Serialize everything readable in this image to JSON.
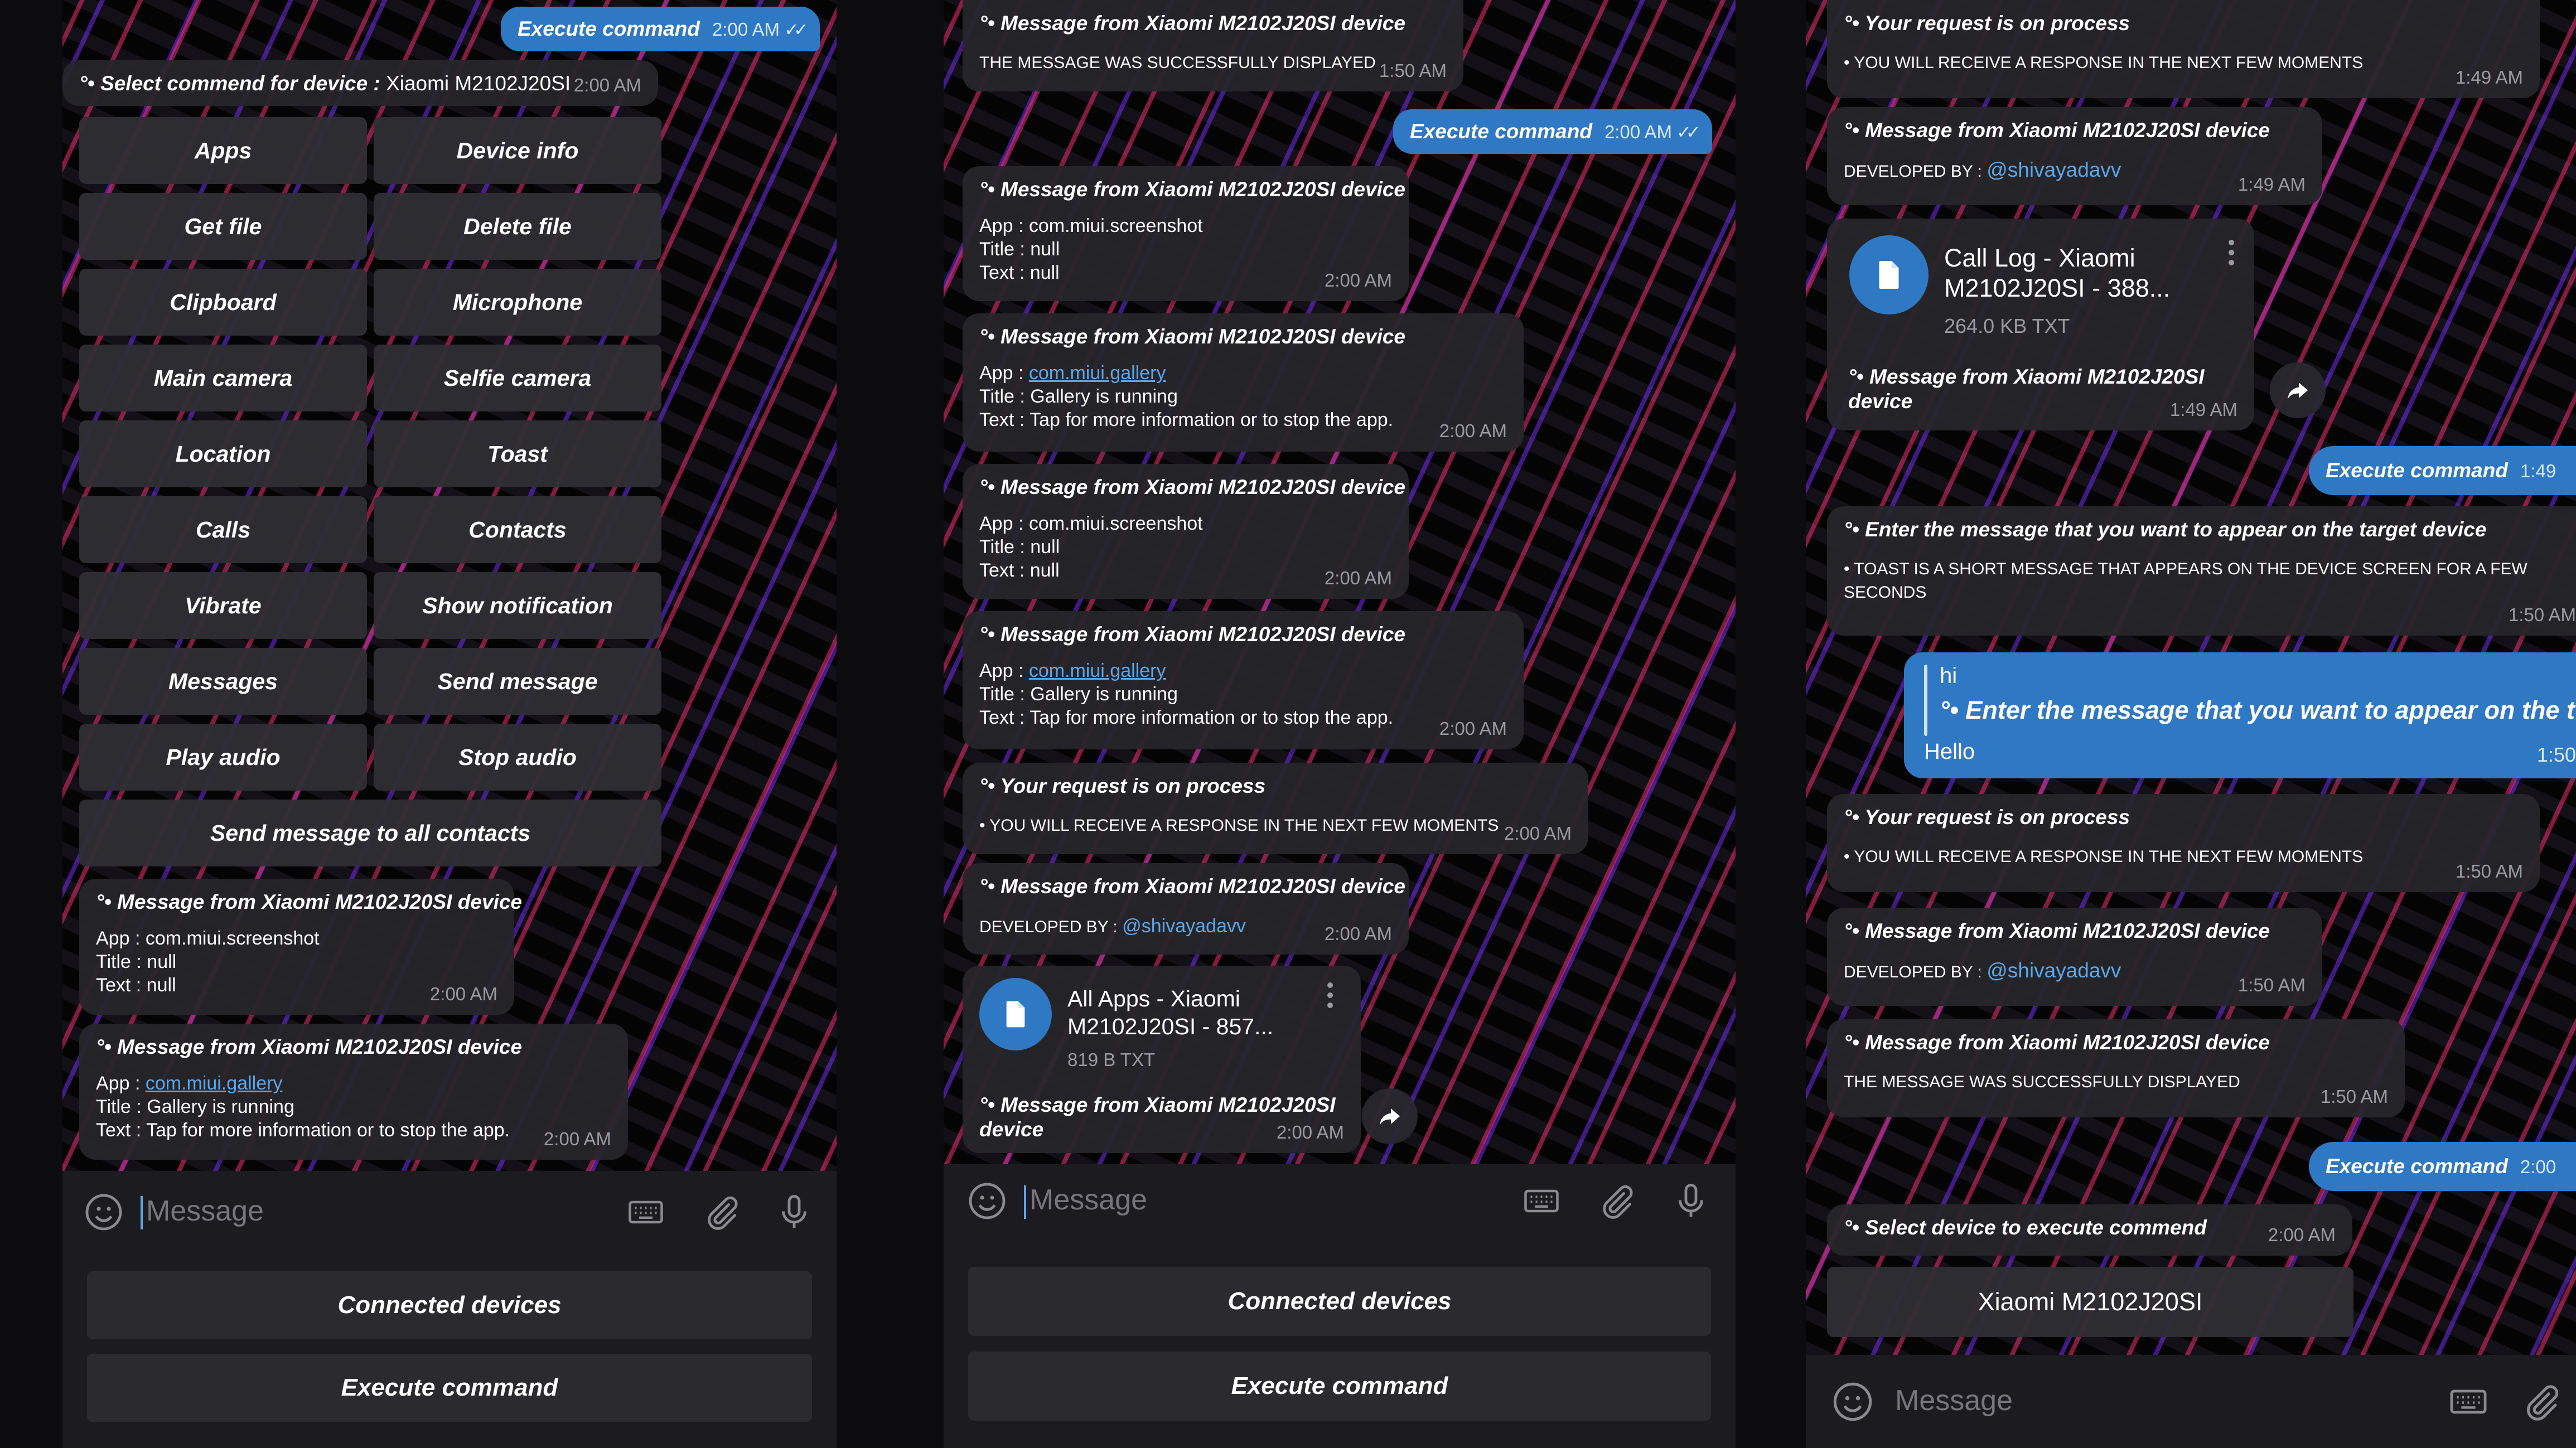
{
  "colors": {
    "accent": "#2f78c4",
    "link": "#5aa7ea",
    "bubble": "#26262a",
    "background": "#0c0c0e"
  },
  "icons": [
    "emoji-icon",
    "keyboard-icon",
    "attach-icon",
    "mic-icon",
    "file-icon",
    "share-icon",
    "more-icon",
    "double-check-icon"
  ],
  "panel1": {
    "execute": {
      "label": "Execute command",
      "time": "2:00 AM"
    },
    "select": {
      "title": "Select commend for device :",
      "device": "Xiaomi M2102J20SI",
      "time": "2:00 AM"
    },
    "buttons": [
      [
        "Apps",
        "Device info"
      ],
      [
        "Get file",
        "Delete file"
      ],
      [
        "Clipboard",
        "Microphone"
      ],
      [
        "Main camera",
        "Selfie camera"
      ],
      [
        "Location",
        "Toast"
      ],
      [
        "Calls",
        "Contacts"
      ],
      [
        "Vibrate",
        "Show notification"
      ],
      [
        "Messages",
        "Send message"
      ],
      [
        "Play audio",
        "Stop audio"
      ]
    ],
    "wide_button": "Send message to all contacts",
    "msg1": {
      "title": "Message from Xiaomi M2102J20SI device",
      "app_label": "App :",
      "app": "com.miui.screenshot",
      "title_line": "Title : null",
      "text_line": "Text : null",
      "time": "2:00 AM"
    },
    "msg2": {
      "title": "Message from Xiaomi M2102J20SI device",
      "app_label": "App :",
      "app": "com.miui.gallery",
      "title_line": "Title : Gallery is running",
      "text_line": "Text : Tap for more information or to stop the app.",
      "time": "2:00 AM"
    },
    "input_placeholder": "Message",
    "reply": [
      "Connected devices",
      "Execute command"
    ]
  },
  "panel2": {
    "m1": {
      "title": "Message from Xiaomi M2102J20SI device",
      "body": "THE MESSAGE WAS SUCCESSFULLY DISPLAYED",
      "time": "1:50 AM"
    },
    "execute": {
      "label": "Execute command",
      "time": "2:00 AM"
    },
    "m2": {
      "title": "Message from Xiaomi M2102J20SI device",
      "app_line": "App : com.miui.screenshot",
      "title_line": "Title : null",
      "text_line": "Text : null",
      "time": "2:00 AM"
    },
    "m3": {
      "title": "Message from Xiaomi M2102J20SI device",
      "app_label": "App :",
      "app": "com.miui.gallery",
      "title_line": "Title : Gallery is running",
      "text_line": "Text : Tap for more information or to stop the app.",
      "time": "2:00 AM"
    },
    "m4": {
      "title": "Message from Xiaomi M2102J20SI device",
      "app_line": "App : com.miui.screenshot",
      "title_line": "Title : null",
      "text_line": "Text : null",
      "time": "2:00 AM"
    },
    "m5": {
      "title": "Message from Xiaomi M2102J20SI device",
      "app_label": "App :",
      "app": "com.miui.gallery",
      "title_line": "Title : Gallery is running",
      "text_line": "Text : Tap for more information or to stop the app.",
      "time": "2:00 AM"
    },
    "m6": {
      "title": "Your request is on process",
      "body": "YOU WILL RECEIVE A RESPONSE IN THE NEXT FEW MOMENTS",
      "time": "2:00 AM"
    },
    "m7": {
      "title": "Message from Xiaomi M2102J20SI device",
      "dev_label": "DEVELOPED BY :",
      "dev": "@shivayadavv",
      "time": "2:00 AM"
    },
    "file": {
      "name_line1": "All Apps  -  Xiaomi",
      "name_line2": "M2102J20SI  -  857...",
      "size": "819 B TXT",
      "caption_line1": "Message from Xiaomi M2102J20SI",
      "caption_line2": "device",
      "time": "2:00 AM"
    },
    "input_placeholder": "Message",
    "reply": [
      "Connected devices",
      "Execute command"
    ]
  },
  "panel3": {
    "m1": {
      "title": "Your request is on process",
      "body": "YOU WILL RECEIVE A RESPONSE IN THE NEXT FEW MOMENTS",
      "time": "1:49 AM"
    },
    "m2": {
      "title": "Message from Xiaomi M2102J20SI device",
      "dev_label": "DEVELOPED BY :",
      "dev": "@shivayadavv",
      "time": "1:49 AM"
    },
    "file": {
      "name_line1": "Call Log  -  Xiaomi",
      "name_line2": "M2102J20SI  -  388...",
      "size": "264.0 KB TXT",
      "caption_line1": "Message from Xiaomi M2102J20SI",
      "caption_line2": "device",
      "time": "1:49 AM"
    },
    "execute1": {
      "label": "Execute command",
      "time": "1:49"
    },
    "m3": {
      "title": "Enter the message that you want to appear on the target device",
      "body_line1": "TOAST IS A SHORT MESSAGE THAT APPEARS ON THE DEVICE SCREEN FOR A FEW",
      "body_line2": "SECONDS",
      "time": "1:50 AM"
    },
    "reply_msg": {
      "quote_name": "hi",
      "quote_text": "Enter the message that you want to appear on the t",
      "text": "Hello",
      "time": "1:50"
    },
    "m4": {
      "title": "Your request is on process",
      "body": "YOU WILL RECEIVE A RESPONSE IN THE NEXT FEW MOMENTS",
      "time": "1:50 AM"
    },
    "m5": {
      "title": "Message from Xiaomi M2102J20SI device",
      "dev_label": "DEVELOPED BY :",
      "dev": "@shivayadavv",
      "time": "1:50 AM"
    },
    "m6": {
      "title": "Message from Xiaomi M2102J20SI device",
      "body": "THE MESSAGE WAS SUCCESSFULLY DISPLAYED",
      "time": "1:50 AM"
    },
    "execute2": {
      "label": "Execute command",
      "time": "2:00"
    },
    "m7": {
      "title": "Select device to execute commend",
      "time": "2:00 AM"
    },
    "device_button": "Xiaomi M2102J20SI",
    "input_placeholder": "Message"
  }
}
